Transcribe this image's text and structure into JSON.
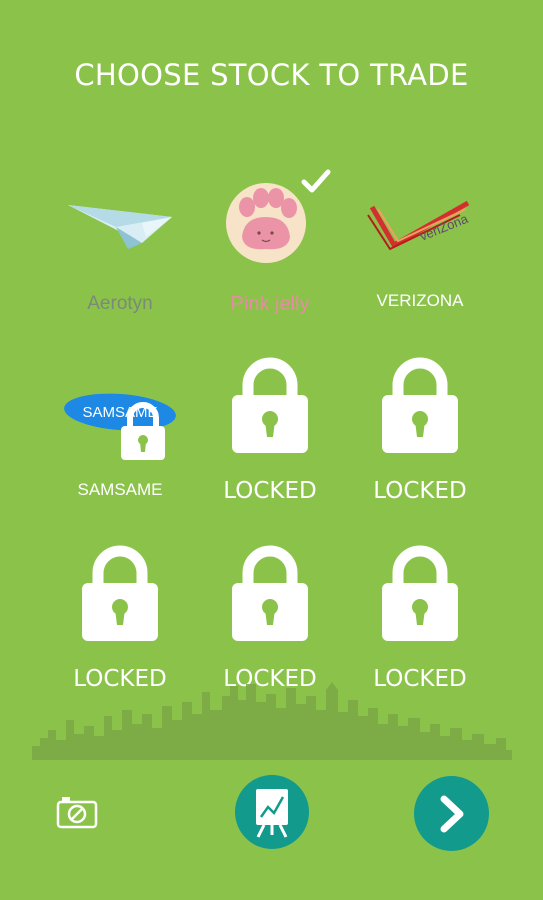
{
  "header": {
    "title": "CHOOSE STOCK TO TRADE"
  },
  "stocks": [
    {
      "label": "Aerotyn",
      "label_color": "#7b8a78",
      "status": "available",
      "icon": "paper-plane-icon"
    },
    {
      "label": "Pink jelly",
      "label_color": "#e98aa6",
      "status": "selected",
      "icon": "paw-icon"
    },
    {
      "label": "VERIZONA",
      "label_color": "#ffffff",
      "status": "available",
      "icon": "verizona-logo",
      "logo_text": "veriZona"
    },
    {
      "label": "SAMSAME",
      "label_color": "#ffffff",
      "status": "locked-with-logo",
      "icon": "samsame-logo",
      "logo_text": "SAMSAME"
    },
    {
      "label": "LOCKED",
      "status": "locked",
      "icon": "lock-icon"
    },
    {
      "label": "LOCKED",
      "status": "locked",
      "icon": "lock-icon"
    },
    {
      "label": "LOCKED",
      "status": "locked",
      "icon": "lock-icon"
    },
    {
      "label": "LOCKED",
      "status": "locked",
      "icon": "lock-icon"
    },
    {
      "label": "LOCKED",
      "status": "locked",
      "icon": "lock-icon"
    }
  ],
  "footer": {
    "camera_icon": "camera-off-icon",
    "chart_button_icon": "chart-easel-icon",
    "next_button_icon": "chevron-right-icon"
  },
  "colors": {
    "background": "#8bc34a",
    "accent": "#129a8d",
    "skyline": "#7aa846"
  }
}
